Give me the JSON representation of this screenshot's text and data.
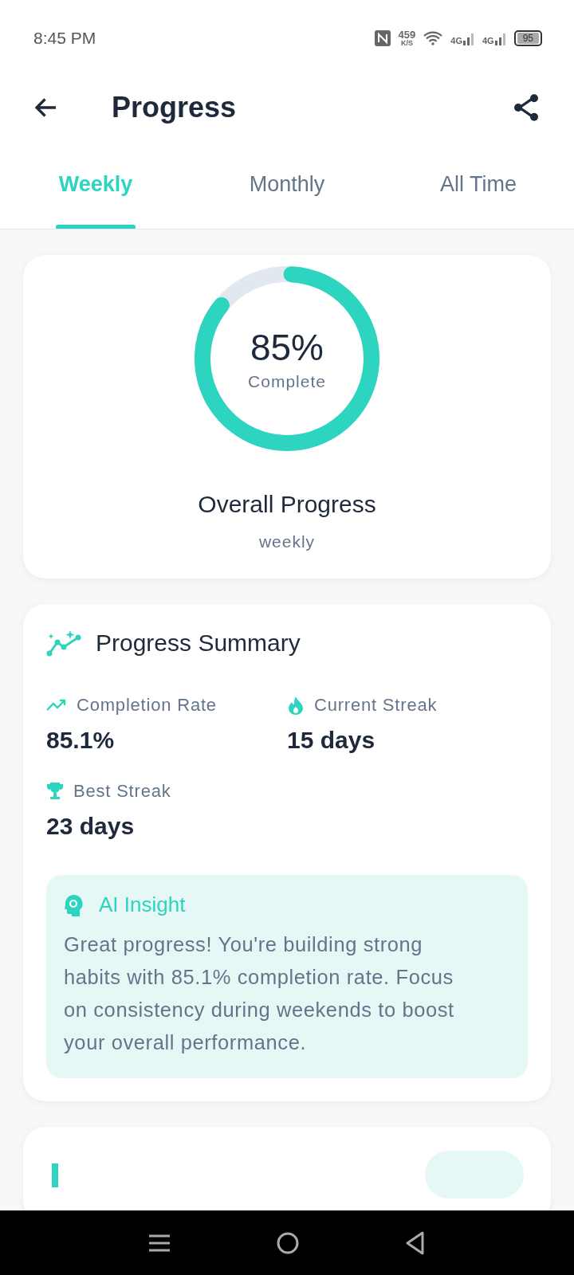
{
  "status_bar": {
    "time": "8:45 PM",
    "speed": "459",
    "speed_unit": "K/S",
    "network_1": "4G",
    "network_2": "4G",
    "battery": "95"
  },
  "header": {
    "title": "Progress"
  },
  "tabs": [
    {
      "label": "Weekly",
      "selected": true
    },
    {
      "label": "Monthly",
      "selected": false
    },
    {
      "label": "All Time",
      "selected": false
    }
  ],
  "overall": {
    "percent": "85%",
    "caption": "Complete",
    "level": 0.85,
    "title": "Overall Progress",
    "period": "weekly"
  },
  "summary": {
    "title": "Progress Summary",
    "stats": [
      {
        "kind": "trend",
        "label": "Completion Rate",
        "value": "85.1%"
      },
      {
        "kind": "flame",
        "label": "Current Streak",
        "value": "15 days"
      },
      {
        "kind": "trophy",
        "label": "Best Streak",
        "value": "23 days"
      }
    ],
    "insight": {
      "title": "AI Insight",
      "text": "Great progress! You're building strong habits with 85.1% completion rate. Focus on consistency during weekends to boost your overall performance."
    }
  }
}
